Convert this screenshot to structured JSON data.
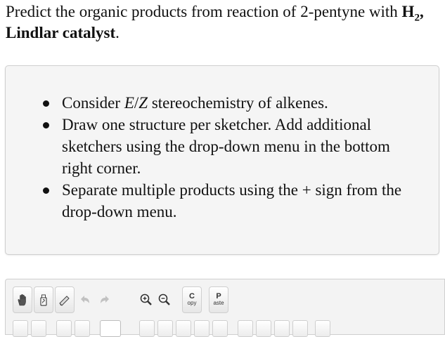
{
  "question": {
    "prefix": "Predict the organic products from reaction of 2-pentyne with",
    "reagent_h": "H",
    "reagent_sub": "2",
    "reagent_rest": ", Lindlar catalyst",
    "period": "."
  },
  "hints": {
    "item1_pre": "Consider ",
    "item1_E": "E",
    "item1_slash": "/",
    "item1_Z": "Z",
    "item1_post": " stereochemistry of alkenes.",
    "item2": "Draw one structure per sketcher. Add additional sketchers using the drop-down menu in the bottom right corner.",
    "item3": "Separate multiple products using the + sign from the drop-down menu."
  },
  "toolbar": {
    "tools": [
      {
        "icon": "hand-icon",
        "enabled": true
      },
      {
        "icon": "erase-all-icon",
        "enabled": true
      },
      {
        "icon": "eraser-icon",
        "enabled": true
      },
      {
        "icon": "undo-icon",
        "enabled": false
      },
      {
        "icon": "redo-icon",
        "enabled": false
      },
      {
        "icon": "zoom-in-icon",
        "enabled": true
      },
      {
        "icon": "zoom-out-icon",
        "enabled": true
      }
    ],
    "copy_big": "C",
    "copy_small": "opy",
    "paste_big": "P",
    "paste_small": "aste"
  }
}
